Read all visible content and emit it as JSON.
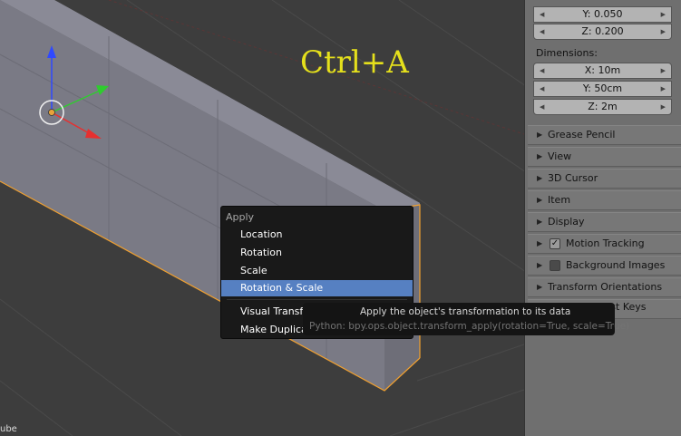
{
  "viewport": {
    "overlay_title": "Ctrl+A",
    "object_label": "ube"
  },
  "panel": {
    "location_fields": [
      "Y: 0.050",
      "Z: 0.200"
    ],
    "dimensions_label": "Dimensions:",
    "dimension_fields": [
      "X: 10m",
      "Y: 50cm",
      "Z: 2m"
    ],
    "sections": [
      {
        "label": "Grease Pencil"
      },
      {
        "label": "View"
      },
      {
        "label": "3D Cursor"
      },
      {
        "label": "Item"
      },
      {
        "label": "Display"
      },
      {
        "label": "Motion Tracking",
        "checked": true
      },
      {
        "label": "Background Images",
        "checked": false
      },
      {
        "label": "Transform Orientations"
      }
    ],
    "partial_section_text": "eencast Keys"
  },
  "menu": {
    "title": "Apply",
    "items": [
      "Location",
      "Rotation",
      "Scale",
      "Rotation & Scale",
      "Visual Transform",
      "Make Duplicat"
    ],
    "selected": "Rotation & Scale"
  },
  "tooltip": {
    "description": "Apply the object's transformation to its data",
    "python": "Python: bpy.ops.object.transform_apply(rotation=True, scale=True)"
  },
  "colors": {
    "overlay_text": "#e5e01c",
    "selection_outline": "#f0a030",
    "menu_highlight": "#5680c2"
  }
}
